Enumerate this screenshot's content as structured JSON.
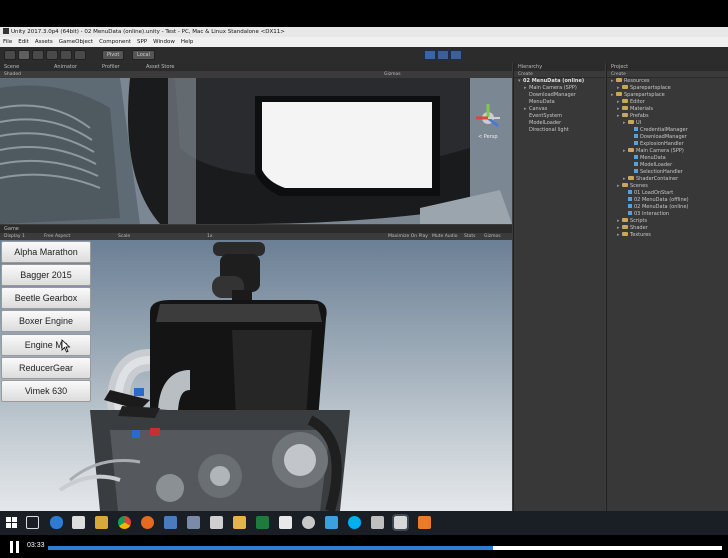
{
  "window": {
    "title": "Unity 2017.3.0p4 (64bit) - 02 MenuData (online).unity - Test - PC, Mac & Linux Standalone <DX11>"
  },
  "menubar": [
    "File",
    "Edit",
    "Assets",
    "GameObject",
    "Component",
    "SPP",
    "Window",
    "Help"
  ],
  "toolbar": {
    "pivot_label": "Pivot",
    "local_label": "Local"
  },
  "scene": {
    "tabs": [
      "Scene",
      "Animator",
      "Profiler",
      "Asset Store"
    ],
    "shading_mode": "Shaded",
    "gizmos_label": "Gizmos",
    "gizmo_persp_label": "< Persp"
  },
  "game": {
    "tab": "Game",
    "display_label": "Display 1",
    "aspect_label": "Free Aspect",
    "scale_label": "Scale",
    "scale_value": "1x",
    "options": [
      "Maximize On Play",
      "Mute Audio",
      "Stats",
      "Gizmos"
    ],
    "menu_buttons": [
      "Alpha Marathon",
      "Bagger 2015",
      "Beetle Gearbox",
      "Boxer Engine",
      "Engine Mk",
      "ReducerGear",
      "Vimek 630"
    ]
  },
  "hierarchy": {
    "tab": "Hierarchy",
    "create_label": "Create",
    "scene_name": "02 MenuData (online)",
    "items": [
      "Main Camera (SPP)",
      "DownloadManager",
      "MenuData",
      "Canvas",
      "EventSystem",
      "ModelLoader",
      "Directional light"
    ]
  },
  "project": {
    "tab": "Project",
    "create_label": "Create",
    "tree": [
      {
        "label": "Resources",
        "depth": 0,
        "kind": "folder"
      },
      {
        "label": "Sparepartsplace",
        "depth": 1,
        "kind": "folder"
      },
      {
        "label": "Sparepartsplace",
        "depth": 0,
        "kind": "folder"
      },
      {
        "label": "Editor",
        "depth": 1,
        "kind": "folder"
      },
      {
        "label": "Materials",
        "depth": 1,
        "kind": "folder"
      },
      {
        "label": "Prefabs",
        "depth": 1,
        "kind": "folder"
      },
      {
        "label": "UI",
        "depth": 2,
        "kind": "folder"
      },
      {
        "label": "CredentialManager",
        "depth": 3,
        "kind": "asset"
      },
      {
        "label": "DownloadManager",
        "depth": 3,
        "kind": "asset"
      },
      {
        "label": "ExplosionHandler",
        "depth": 3,
        "kind": "asset"
      },
      {
        "label": "Main Camera (SPP)",
        "depth": 2,
        "kind": "folder"
      },
      {
        "label": "MenuData",
        "depth": 3,
        "kind": "asset"
      },
      {
        "label": "ModelLoader",
        "depth": 3,
        "kind": "asset"
      },
      {
        "label": "SelectionHandler",
        "depth": 3,
        "kind": "asset"
      },
      {
        "label": "ShaderContainer",
        "depth": 2,
        "kind": "folder"
      },
      {
        "label": "Scenes",
        "depth": 1,
        "kind": "folder"
      },
      {
        "label": "01 LoadOnStart",
        "depth": 2,
        "kind": "asset"
      },
      {
        "label": "02 MenuData (offline)",
        "depth": 2,
        "kind": "asset"
      },
      {
        "label": "02 MenuData (online)",
        "depth": 2,
        "kind": "asset"
      },
      {
        "label": "03 Interaction",
        "depth": 2,
        "kind": "asset"
      },
      {
        "label": "Scripts",
        "depth": 1,
        "kind": "folder"
      },
      {
        "label": "Shader",
        "depth": 1,
        "kind": "folder"
      },
      {
        "label": "Textures",
        "depth": 1,
        "kind": "folder"
      }
    ]
  },
  "taskbar": {
    "icons": [
      "windows-start-icon",
      "task-view-icon",
      "edge-icon",
      "store-icon",
      "explorer-icon",
      "chrome-icon",
      "firefox-icon",
      "app-icon",
      "app-icon",
      "app-icon",
      "folder-icon",
      "spreadsheet-icon",
      "app-icon",
      "settings-icon",
      "app-icon",
      "skype-icon",
      "app-icon",
      "unity-icon",
      "app-icon"
    ]
  },
  "video": {
    "time": "03:33",
    "progress": 0.66
  },
  "colors": {
    "progress": "#2d7fd4",
    "editor_bg": "#3c3c3c",
    "folder": "#c9a75a"
  }
}
